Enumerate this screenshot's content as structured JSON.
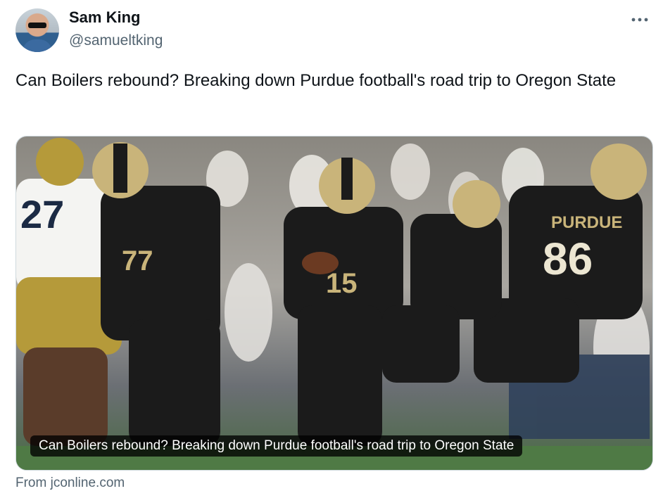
{
  "user": {
    "display_name": "Sam King",
    "handle": "@samueltking",
    "avatar_icon": "profile-photo"
  },
  "menu": {
    "icon": "more-horizontal-icon"
  },
  "tweet": {
    "text": "Can Boilers rebound? Breaking down Purdue football's road trip to Oregon State"
  },
  "card": {
    "image_caption": "Can Boilers rebound? Breaking down Purdue football's road trip to Oregon State",
    "source": "From jconline.com",
    "jersey_numbers": [
      "27",
      "77",
      "15",
      "86"
    ],
    "team_wordmark": "PURDUE",
    "colors": {
      "purdue_black": "#1b1b1b",
      "purdue_gold": "#c9b47a",
      "opponent_gold": "#b59a3a",
      "field_green": "#4f7a45"
    }
  }
}
